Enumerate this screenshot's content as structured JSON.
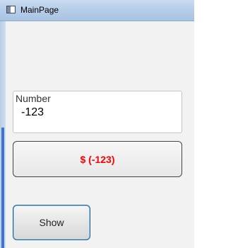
{
  "window": {
    "title": "MainPage",
    "app_icon": "window-icon"
  },
  "form": {
    "number_label": "Number",
    "number_value": "-123",
    "result_text": "$ (-123)",
    "result_color": "#ff0000",
    "show_button_label": "Show"
  }
}
